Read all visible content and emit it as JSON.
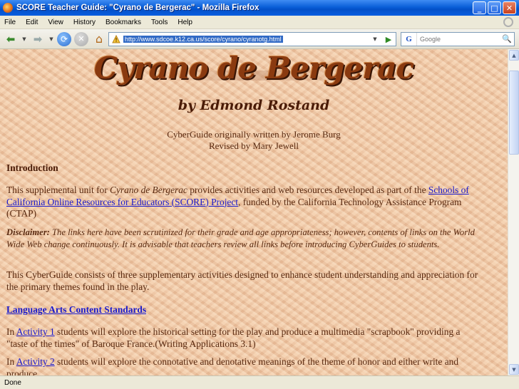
{
  "window": {
    "title": "SCORE Teacher Guide: \"Cyrano de Bergerac\" - Mozilla Firefox",
    "minimize": "_",
    "maximize": "□",
    "close": "✕"
  },
  "menu": [
    "File",
    "Edit",
    "View",
    "History",
    "Bookmarks",
    "Tools",
    "Help"
  ],
  "nav": {
    "url": "http://www.sdcoe.k12.ca.us/score/cyrano/cyranotg.html",
    "search_placeholder": "Google",
    "search_engine_letter": "G"
  },
  "page": {
    "title": "Cyrano de Bergerac",
    "byline": "by Edmond Rostand",
    "credit_line1": "CyberGuide originally written by Jerome Burg",
    "credit_line2": "Revised by Mary Jewell",
    "intro_heading": "Introduction",
    "p1_before": "This supplemental unit for ",
    "p1_italic": "Cyrano de Bergerac",
    "p1_mid": " provides activities and web resources developed as part of the ",
    "p1_link": "Schools of California Online Resources for Educators (SCORE) Project",
    "p1_after": ", funded by the California Technology Assistance Program (CTAP)",
    "disclaimer_label": "Disclaimer:",
    "disclaimer_text": " The links here have been scrutinized for their grade and age appropriateness; however, contents of links on the World Wide Web change continuously. It is advisable that teachers review all links before introducing CyberGuides to students.",
    "p3": "This CyberGuide consists of three supplementary activities designed to enhance student understanding and appreciation for the primary themes found in the play.",
    "standards_link": "Language Arts Content Standards",
    "p4_before": "In ",
    "p4_link": "Activity 1",
    "p4_after": " students will explore the historical setting for the play and produce a multimedia \"scrapbook\" providing a \"taste of the times\" of Baroque France.(Writing Applications 3.1)",
    "p5_before": "In ",
    "p5_link": "Activity 2",
    "p5_after": " students will explore the connotative and denotative meanings of the theme of honor and either write and produce"
  },
  "status": "Done",
  "colors": {
    "page_background": "#efc7a4",
    "body_text": "#5a2b12",
    "link": "#1a1acc",
    "title_bar": "#0a5fd8"
  }
}
